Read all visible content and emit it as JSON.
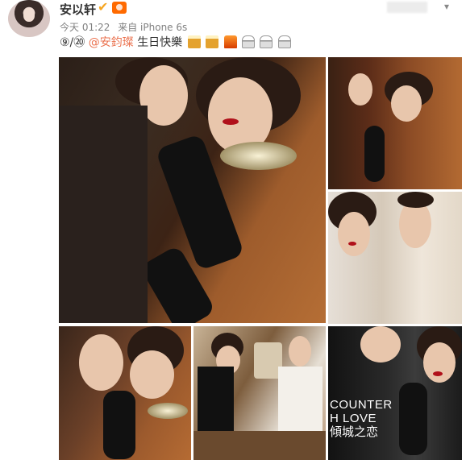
{
  "post": {
    "username": "安以轩",
    "verified_icon": "v-verified-icon",
    "member_icon": "member-badge-icon",
    "menu_icon": "chevron-down-icon",
    "time": "今天 01:22",
    "source": "来自 iPhone 6s",
    "content": {
      "date_prefix": "⑨/⑳",
      "mention": "@安鈞璨",
      "text": " 生日快樂",
      "emojis": [
        "beer-icon",
        "beer-icon",
        "crown-icon",
        "cake-icon",
        "cake-icon",
        "cake-icon"
      ]
    }
  },
  "photos": [
    {
      "name": "couple-portrait-main"
    },
    {
      "name": "couple-portrait-2"
    },
    {
      "name": "couple-portrait-3"
    },
    {
      "name": "couple-portrait-4"
    },
    {
      "name": "couple-portrait-5"
    },
    {
      "name": "magazine-cover",
      "overlay_en_line1": "COUNTER",
      "overlay_en_line2": "H LOVE",
      "overlay_cn": "傾城之恋"
    }
  ],
  "colors": {
    "mention": "#eb7350",
    "username": "#333333",
    "meta": "#808080"
  }
}
